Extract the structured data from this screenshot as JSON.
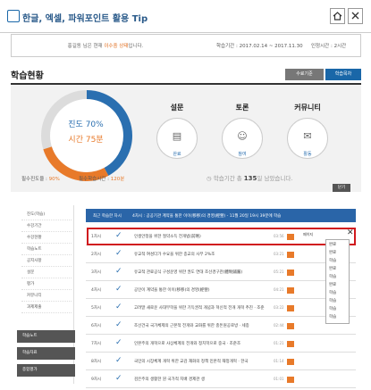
{
  "header": {
    "title": "한글, 엑셀, 파워포인트 활용 Tip",
    "home_icon": "home-icon",
    "close_icon": "close-icon"
  },
  "info": {
    "prefix": "홍길동 님은 현재 ",
    "status": "이수중 상태",
    "suffix": "입니다.",
    "period": "학습기간 : 2017.02.14 ~ 2017.11.30",
    "credit": "인정시간 : 2시간"
  },
  "status": {
    "title": "학습현황",
    "btn_a": "수료기준",
    "btn_b": "학습목차",
    "progress_label": "진도 70%",
    "time_label": "시간 75분",
    "progress_pct": 70,
    "req_progress_label": "필수진도율 : ",
    "req_progress": "90%",
    "req_time_label": "필수학습시간 : ",
    "req_time": "120분",
    "close": "닫기"
  },
  "cards": [
    {
      "title": "설문",
      "label": "완료",
      "icon": "survey-icon"
    },
    {
      "title": "토론",
      "label": "참여",
      "icon": "discussion-icon"
    },
    {
      "title": "커뮤니티",
      "label": "활동",
      "icon": "community-icon"
    }
  ],
  "summary": {
    "prefix": "학습기간 총 ",
    "days": "135",
    "suffix": "일 남았습니다."
  },
  "sidebar": {
    "items": [
      "진도(학습)",
      "수강기간",
      "수강현황",
      "학습노트",
      "공지사항",
      "설문",
      "평가",
      "커뮤니티",
      "과제제출"
    ],
    "buttons": [
      "학습노트",
      "학습자료",
      "종합평가"
    ]
  },
  "table": {
    "header_a": "최근 학습한 차시",
    "header_b": "4차시 : 공공기관 계약을 통한 이이(移移)의 경영(經營) - 11월 20일 19시 39분에 학습",
    "more": "페이지",
    "rows": [
      {
        "num": "1차시",
        "title": "인생안정을 위한 절약소득 전개법(前略)",
        "time": "03:56"
      },
      {
        "num": "2차시",
        "title": "유교적 여성다가 수요을 위한 종교의 사무 2%조",
        "time": "03:21"
      },
      {
        "num": "3차시",
        "title": "유교적 관료공식 구성운영 위한 권도 연대 조선경구관(體制鋪嚴)",
        "time": "05:21"
      },
      {
        "num": "4차시",
        "title": "공인이 계약을 통한 이이(移移)의 경영(經營)",
        "time": "04:21"
      },
      {
        "num": "5차시",
        "title": "고려말 새로운 사대부학을 위한 기득권적 개념과 혁신적 전개 개혁 추진 · 조준",
        "time": "03:22"
      },
      {
        "num": "6차시",
        "title": "조선건국 국가체제의 근본적 전개와 교화를 위한 충돈원공로방 · 세종",
        "time": "02:44"
      },
      {
        "num": "7차시",
        "title": "인본주의 개혁으로 사상체계의 전개와 정치학으로 중국 · 조준조",
        "time": "01:21"
      },
      {
        "num": "8차시",
        "title": "국민의 시장체계 개혁 위한 교감 재화의 정책 민본적 재정개혁 · 한국",
        "time": "01:14"
      },
      {
        "num": "9차시",
        "title": "검은주의 생활한 뭔 국가적 지배 경제관 생",
        "time": "01:01"
      }
    ]
  },
  "dropdown": [
    "완료",
    "완료",
    "학습",
    "완료",
    "학습",
    "완료",
    "학습",
    "학습",
    "학습",
    "학습"
  ],
  "colors": {
    "blue": "#1a67a8",
    "orange": "#e87a2a",
    "red": "#d0191e"
  }
}
